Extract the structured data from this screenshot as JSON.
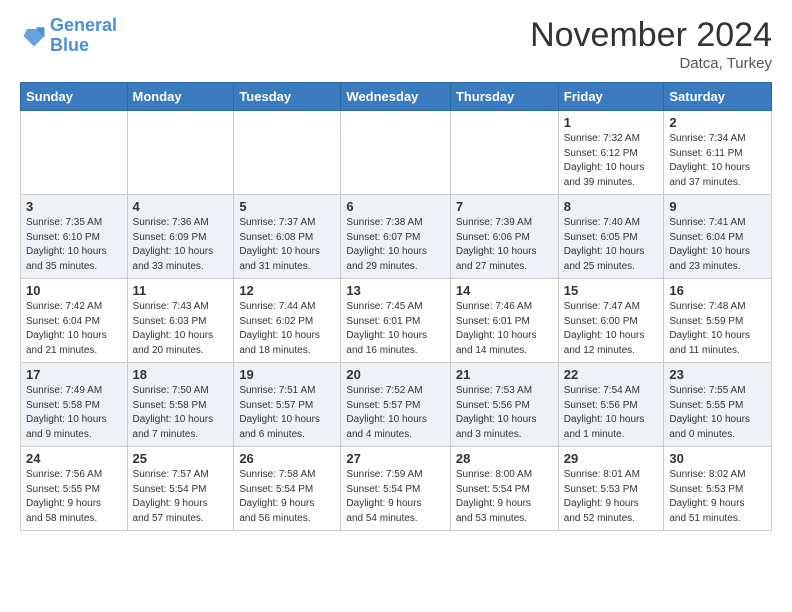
{
  "header": {
    "logo_line1": "General",
    "logo_line2": "Blue",
    "month": "November 2024",
    "location": "Datca, Turkey"
  },
  "weekdays": [
    "Sunday",
    "Monday",
    "Tuesday",
    "Wednesday",
    "Thursday",
    "Friday",
    "Saturday"
  ],
  "weeks": [
    [
      {
        "day": "",
        "info": ""
      },
      {
        "day": "",
        "info": ""
      },
      {
        "day": "",
        "info": ""
      },
      {
        "day": "",
        "info": ""
      },
      {
        "day": "",
        "info": ""
      },
      {
        "day": "1",
        "info": "Sunrise: 7:32 AM\nSunset: 6:12 PM\nDaylight: 10 hours\nand 39 minutes."
      },
      {
        "day": "2",
        "info": "Sunrise: 7:34 AM\nSunset: 6:11 PM\nDaylight: 10 hours\nand 37 minutes."
      }
    ],
    [
      {
        "day": "3",
        "info": "Sunrise: 7:35 AM\nSunset: 6:10 PM\nDaylight: 10 hours\nand 35 minutes."
      },
      {
        "day": "4",
        "info": "Sunrise: 7:36 AM\nSunset: 6:09 PM\nDaylight: 10 hours\nand 33 minutes."
      },
      {
        "day": "5",
        "info": "Sunrise: 7:37 AM\nSunset: 6:08 PM\nDaylight: 10 hours\nand 31 minutes."
      },
      {
        "day": "6",
        "info": "Sunrise: 7:38 AM\nSunset: 6:07 PM\nDaylight: 10 hours\nand 29 minutes."
      },
      {
        "day": "7",
        "info": "Sunrise: 7:39 AM\nSunset: 6:06 PM\nDaylight: 10 hours\nand 27 minutes."
      },
      {
        "day": "8",
        "info": "Sunrise: 7:40 AM\nSunset: 6:05 PM\nDaylight: 10 hours\nand 25 minutes."
      },
      {
        "day": "9",
        "info": "Sunrise: 7:41 AM\nSunset: 6:04 PM\nDaylight: 10 hours\nand 23 minutes."
      }
    ],
    [
      {
        "day": "10",
        "info": "Sunrise: 7:42 AM\nSunset: 6:04 PM\nDaylight: 10 hours\nand 21 minutes."
      },
      {
        "day": "11",
        "info": "Sunrise: 7:43 AM\nSunset: 6:03 PM\nDaylight: 10 hours\nand 20 minutes."
      },
      {
        "day": "12",
        "info": "Sunrise: 7:44 AM\nSunset: 6:02 PM\nDaylight: 10 hours\nand 18 minutes."
      },
      {
        "day": "13",
        "info": "Sunrise: 7:45 AM\nSunset: 6:01 PM\nDaylight: 10 hours\nand 16 minutes."
      },
      {
        "day": "14",
        "info": "Sunrise: 7:46 AM\nSunset: 6:01 PM\nDaylight: 10 hours\nand 14 minutes."
      },
      {
        "day": "15",
        "info": "Sunrise: 7:47 AM\nSunset: 6:00 PM\nDaylight: 10 hours\nand 12 minutes."
      },
      {
        "day": "16",
        "info": "Sunrise: 7:48 AM\nSunset: 5:59 PM\nDaylight: 10 hours\nand 11 minutes."
      }
    ],
    [
      {
        "day": "17",
        "info": "Sunrise: 7:49 AM\nSunset: 5:58 PM\nDaylight: 10 hours\nand 9 minutes."
      },
      {
        "day": "18",
        "info": "Sunrise: 7:50 AM\nSunset: 5:58 PM\nDaylight: 10 hours\nand 7 minutes."
      },
      {
        "day": "19",
        "info": "Sunrise: 7:51 AM\nSunset: 5:57 PM\nDaylight: 10 hours\nand 6 minutes."
      },
      {
        "day": "20",
        "info": "Sunrise: 7:52 AM\nSunset: 5:57 PM\nDaylight: 10 hours\nand 4 minutes."
      },
      {
        "day": "21",
        "info": "Sunrise: 7:53 AM\nSunset: 5:56 PM\nDaylight: 10 hours\nand 3 minutes."
      },
      {
        "day": "22",
        "info": "Sunrise: 7:54 AM\nSunset: 5:56 PM\nDaylight: 10 hours\nand 1 minute."
      },
      {
        "day": "23",
        "info": "Sunrise: 7:55 AM\nSunset: 5:55 PM\nDaylight: 10 hours\nand 0 minutes."
      }
    ],
    [
      {
        "day": "24",
        "info": "Sunrise: 7:56 AM\nSunset: 5:55 PM\nDaylight: 9 hours\nand 58 minutes."
      },
      {
        "day": "25",
        "info": "Sunrise: 7:57 AM\nSunset: 5:54 PM\nDaylight: 9 hours\nand 57 minutes."
      },
      {
        "day": "26",
        "info": "Sunrise: 7:58 AM\nSunset: 5:54 PM\nDaylight: 9 hours\nand 56 minutes."
      },
      {
        "day": "27",
        "info": "Sunrise: 7:59 AM\nSunset: 5:54 PM\nDaylight: 9 hours\nand 54 minutes."
      },
      {
        "day": "28",
        "info": "Sunrise: 8:00 AM\nSunset: 5:54 PM\nDaylight: 9 hours\nand 53 minutes."
      },
      {
        "day": "29",
        "info": "Sunrise: 8:01 AM\nSunset: 5:53 PM\nDaylight: 9 hours\nand 52 minutes."
      },
      {
        "day": "30",
        "info": "Sunrise: 8:02 AM\nSunset: 5:53 PM\nDaylight: 9 hours\nand 51 minutes."
      }
    ]
  ]
}
